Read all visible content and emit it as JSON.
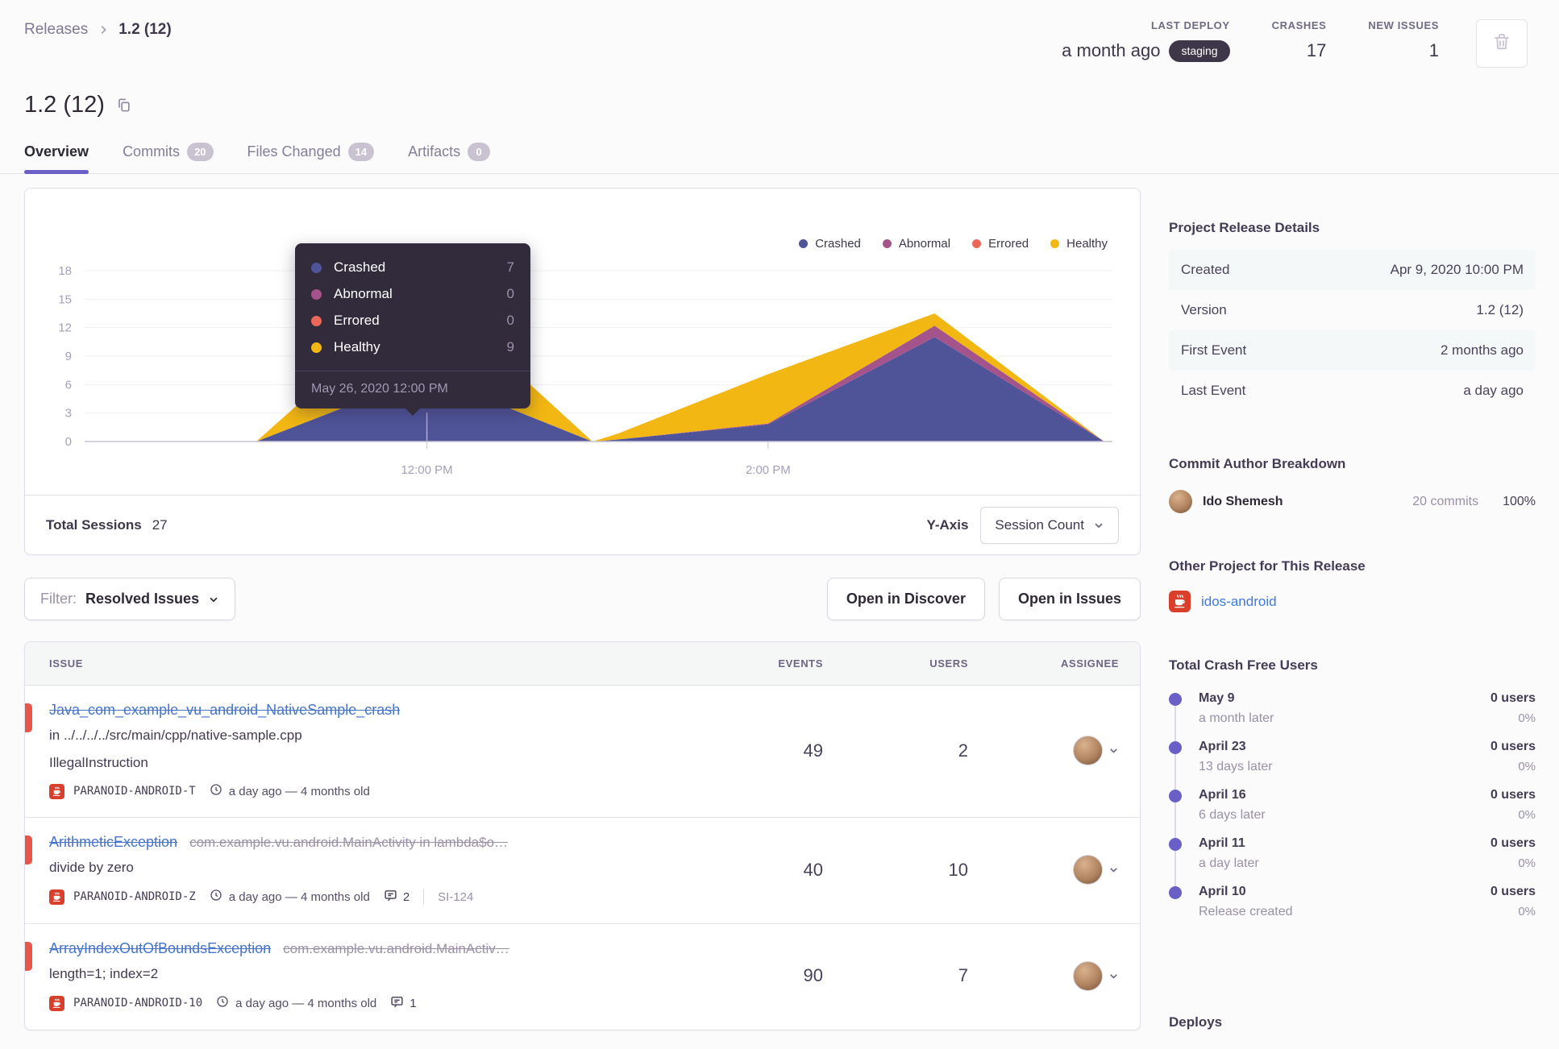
{
  "breadcrumb": {
    "root": "Releases",
    "current": "1.2 (12)"
  },
  "header": {
    "stats": [
      {
        "label": "LAST DEPLOY",
        "value": "a month ago",
        "badge": "staging"
      },
      {
        "label": "CRASHES",
        "value": "17"
      },
      {
        "label": "NEW ISSUES",
        "value": "1"
      }
    ]
  },
  "release": {
    "title": "1.2 (12)"
  },
  "tabs": [
    {
      "label": "Overview"
    },
    {
      "label": "Commits",
      "count": "20"
    },
    {
      "label": "Files Changed",
      "count": "14"
    },
    {
      "label": "Artifacts",
      "count": "0"
    }
  ],
  "chart_data": {
    "type": "area",
    "stacked": true,
    "grid": true,
    "legend_position": "top-right",
    "x_ticks": [
      {
        "label": "12:00 PM",
        "t": 0.333
      },
      {
        "label": "2:00 PM",
        "t": 0.665
      }
    ],
    "y_ticks": [
      0,
      3,
      6,
      9,
      12,
      15,
      18
    ],
    "ylim": [
      0,
      18
    ],
    "series": [
      {
        "name": "Crashed",
        "color": "#4f5499",
        "points": [
          [
            0.167,
            0
          ],
          [
            0.333,
            7
          ],
          [
            0.494,
            0
          ],
          [
            0.518,
            0.2
          ],
          [
            0.665,
            1.8
          ],
          [
            0.827,
            11
          ],
          [
            0.992,
            0
          ]
        ]
      },
      {
        "name": "Abnormal",
        "color": "#a4548a",
        "points": [
          [
            0.167,
            0
          ],
          [
            0.333,
            0
          ],
          [
            0.494,
            0
          ],
          [
            0.518,
            0
          ],
          [
            0.665,
            0.1
          ],
          [
            0.827,
            1.2
          ],
          [
            0.992,
            0
          ]
        ]
      },
      {
        "name": "Errored",
        "color": "#ea6857",
        "points": [
          [
            0.167,
            0
          ],
          [
            0.333,
            0
          ],
          [
            0.494,
            0
          ],
          [
            0.518,
            0
          ],
          [
            0.665,
            0
          ],
          [
            0.827,
            0
          ],
          [
            0.992,
            0
          ]
        ]
      },
      {
        "name": "Healthy",
        "color": "#f2b712",
        "points": [
          [
            0.167,
            0
          ],
          [
            0.333,
            9
          ],
          [
            0.494,
            0
          ],
          [
            0.518,
            0.6
          ],
          [
            0.665,
            5.2
          ],
          [
            0.827,
            1.3
          ],
          [
            0.992,
            0
          ]
        ]
      }
    ],
    "hover_point": {
      "time": "May 26, 2020 12:00 PM",
      "Crashed": 7,
      "Abnormal": 0,
      "Errored": 0,
      "Healthy": 9
    },
    "total_sessions": 27
  },
  "tooltip": {
    "rows": [
      {
        "label": "Crashed",
        "value": "7",
        "color": "#4f5499"
      },
      {
        "label": "Abnormal",
        "value": "0",
        "color": "#a4548a"
      },
      {
        "label": "Errored",
        "value": "0",
        "color": "#ea6857"
      },
      {
        "label": "Healthy",
        "value": "9",
        "color": "#f2b712"
      }
    ],
    "timestamp": "May 26, 2020 12:00 PM"
  },
  "chart_footer": {
    "total_label": "Total Sessions",
    "total_value": "27",
    "y_axis_label": "Y-Axis",
    "y_axis_value": "Session Count"
  },
  "toolbar": {
    "filter_label": "Filter:",
    "filter_value": "Resolved Issues",
    "open_discover": "Open in Discover",
    "open_issues": "Open in Issues"
  },
  "issues": {
    "headers": {
      "issue": "ISSUE",
      "events": "EVENTS",
      "users": "USERS",
      "assignee": "ASSIGNEE"
    },
    "rows": [
      {
        "title": "Java_com_example_vu_android_NativeSample_crash",
        "culprit": "",
        "location": "in ../../../../src/main/cpp/native-sample.cpp",
        "message": "IllegalInstruction",
        "project": "PARANOID-ANDROID-T",
        "age": "a day ago — 4 months old",
        "comments": "",
        "short_id": "",
        "events": "49",
        "users": "2"
      },
      {
        "title": "ArithmeticException",
        "culprit": "com.example.vu.android.MainActivity in lambda$o…",
        "location": "",
        "message": "divide by zero",
        "project": "PARANOID-ANDROID-Z",
        "age": "a day ago — 4 months old",
        "comments": "2",
        "short_id": "SI-124",
        "events": "40",
        "users": "10"
      },
      {
        "title": "ArrayIndexOutOfBoundsException",
        "culprit": "com.example.vu.android.MainActiv…",
        "location": "",
        "message": "length=1; index=2",
        "project": "PARANOID-ANDROID-10",
        "age": "a day ago — 4 months old",
        "comments": "1",
        "short_id": "",
        "events": "90",
        "users": "7"
      }
    ]
  },
  "sidebar": {
    "details": {
      "heading": "Project Release Details",
      "rows": [
        {
          "label": "Created",
          "value": "Apr 9, 2020 10:00 PM"
        },
        {
          "label": "Version",
          "value": "1.2 (12)"
        },
        {
          "label": "First Event",
          "value": "2 months ago"
        },
        {
          "label": "Last Event",
          "value": "a day ago"
        }
      ]
    },
    "authors": {
      "heading": "Commit Author Breakdown",
      "name": "Ido Shemesh",
      "commits": "20 commits",
      "percent": "100%"
    },
    "other_project": {
      "heading": "Other Project for This Release",
      "name": "idos-android"
    },
    "crash_free": {
      "heading": "Total Crash Free Users",
      "items": [
        {
          "date": "May 9",
          "note": "a month later",
          "users": "0 users",
          "pct": "0%"
        },
        {
          "date": "April 23",
          "note": "13 days later",
          "users": "0 users",
          "pct": "0%"
        },
        {
          "date": "April 16",
          "note": "6 days later",
          "users": "0 users",
          "pct": "0%"
        },
        {
          "date": "April 11",
          "note": "a day later",
          "users": "0 users",
          "pct": "0%"
        },
        {
          "date": "April 10",
          "note": "Release created",
          "users": "0 users",
          "pct": "0%"
        }
      ]
    },
    "deploys_heading": "Deploys"
  },
  "colors": {
    "accent": "#6c5fc7",
    "link": "#4674ca",
    "resolved_marker": "#e8564a",
    "staging_badge": "#3e3749"
  }
}
